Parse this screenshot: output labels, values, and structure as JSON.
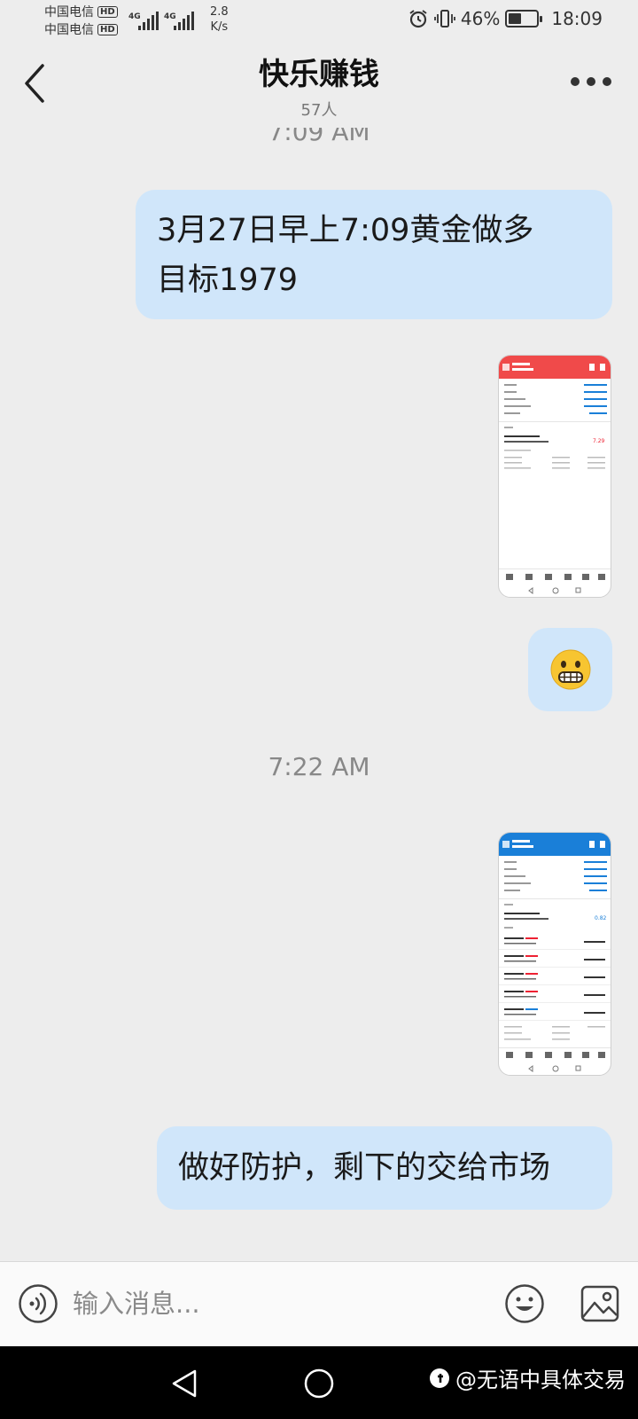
{
  "status_bar": {
    "carrier_1": "中国电信",
    "carrier_2": "中国电信",
    "hd_badge": "HD",
    "network_1": "4G",
    "network_2": "4G",
    "speed_value": "2.8",
    "speed_unit": "K/s",
    "battery_percent": "46%",
    "battery_level": 0.46,
    "time": "18:09",
    "icons": [
      "alarm-icon",
      "vibrate-icon",
      "signal-icon",
      "battery-icon"
    ]
  },
  "header": {
    "title": "快乐赚钱",
    "member_count": "57人",
    "icons": [
      "back-icon",
      "more-icon"
    ]
  },
  "chat": {
    "timestamp_top": "7:09 AM",
    "message_1": {
      "line1": "3月27日早上7:09黄金做多",
      "line2": "目标1979"
    },
    "screenshot_1": {
      "accent": "#f04a4a",
      "balance_value": "7.29",
      "type": "image"
    },
    "sticker_emoji": "😬",
    "timestamp_2": "7:22 AM",
    "screenshot_2": {
      "accent": "#1a7fd8",
      "balance_value": "0.82",
      "type": "image"
    },
    "message_2": "做好防护，剩下的交给市场"
  },
  "input_bar": {
    "placeholder": "输入消息...",
    "icons": [
      "voice-icon",
      "emoji-icon",
      "image-icon"
    ]
  },
  "nav_bar": {
    "watermark_text": "@无语中具体交易",
    "icons": [
      "nav-back-icon",
      "nav-home-icon"
    ]
  },
  "colors": {
    "bubble": "#d0e6fa",
    "background": "#ededed"
  }
}
